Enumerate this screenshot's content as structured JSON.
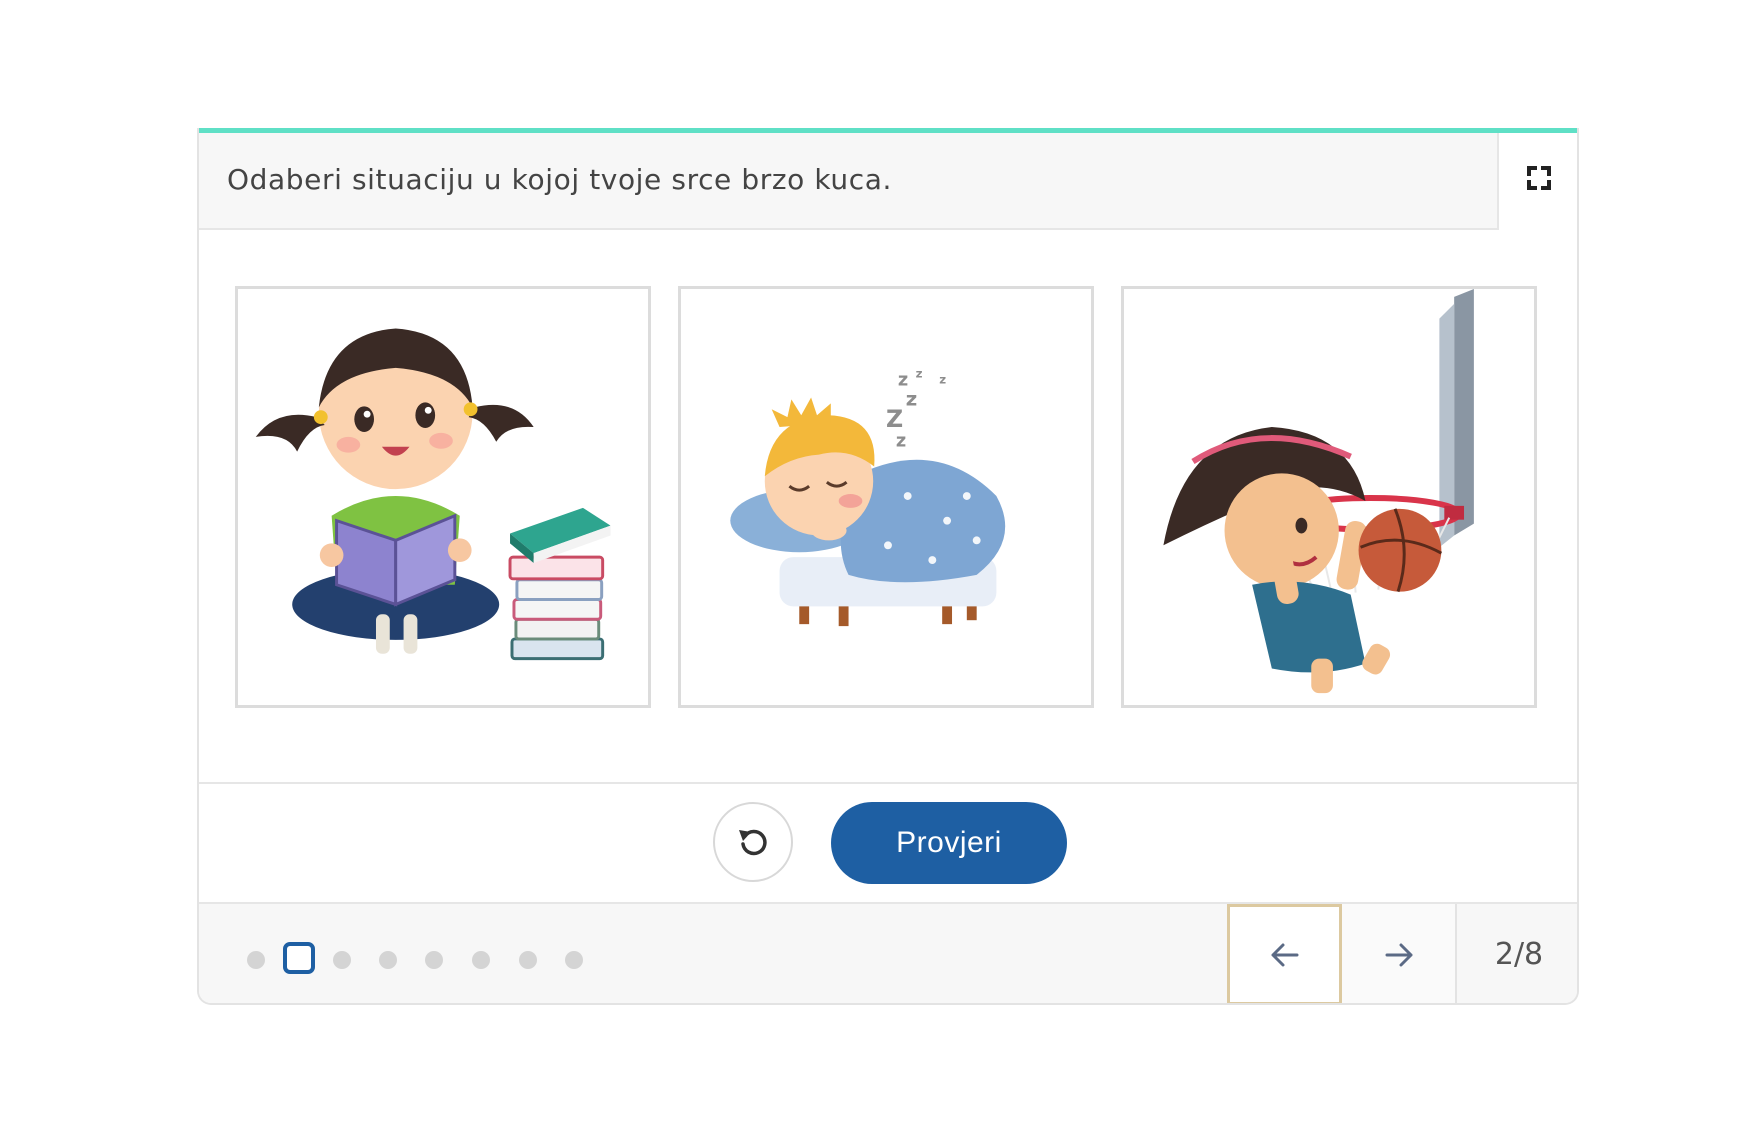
{
  "question": {
    "text": "Odaberi situaciju u kojoj tvoje srce brzo kuca."
  },
  "toolbar": {
    "fullscreen_icon": "fullscreen-icon"
  },
  "options": [
    {
      "name": "girl-reading-books",
      "icon": "image"
    },
    {
      "name": "child-sleeping",
      "icon": "image"
    },
    {
      "name": "girl-playing-basketball",
      "icon": "image"
    }
  ],
  "actions": {
    "reset_icon": "reset-icon",
    "check_label": "Provjeri"
  },
  "pagination": {
    "total": 8,
    "current": 2,
    "counter_text": "2/8",
    "prev_icon": "arrow-left-icon",
    "next_icon": "arrow-right-icon"
  },
  "colors": {
    "accent": "#5fe0c6",
    "primary": "#1e5fa3",
    "focus_outline": "#dcc9a0"
  }
}
